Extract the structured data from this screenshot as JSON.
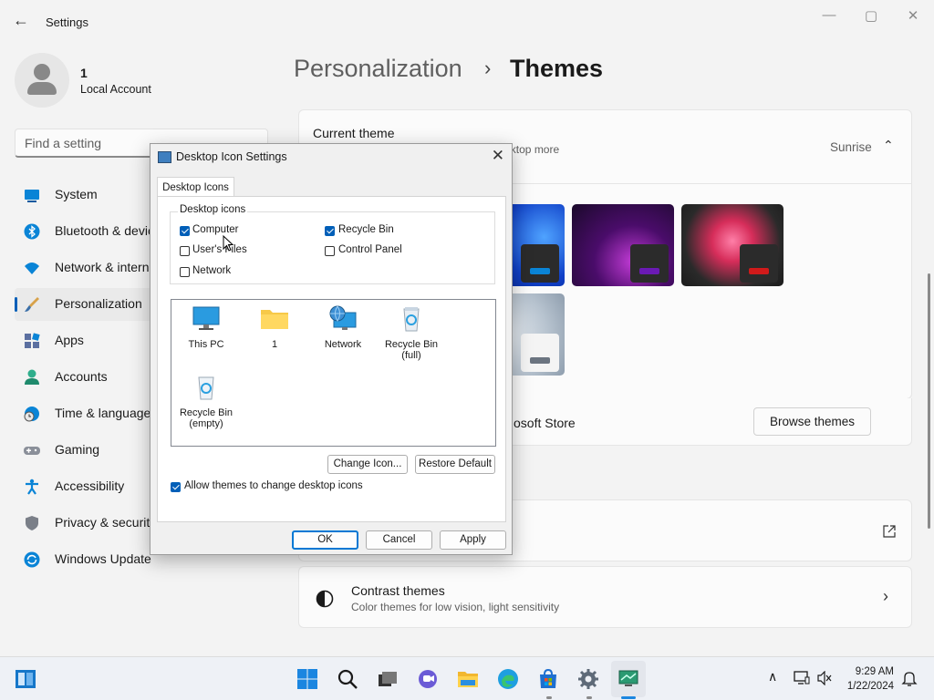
{
  "window": {
    "title": "Settings",
    "controls": {
      "minimize": "—",
      "maximize": "▢",
      "close": "✕"
    }
  },
  "user": {
    "name": "1",
    "account_type": "Local Account"
  },
  "search": {
    "placeholder": "Find a setting"
  },
  "sidebar": {
    "items": [
      {
        "label": "System",
        "icon": "system-icon"
      },
      {
        "label": "Bluetooth & devices",
        "icon": "bluetooth-icon"
      },
      {
        "label": "Network & internet",
        "icon": "network-icon"
      },
      {
        "label": "Personalization",
        "icon": "brush-icon",
        "active": true
      },
      {
        "label": "Apps",
        "icon": "apps-icon"
      },
      {
        "label": "Accounts",
        "icon": "accounts-icon"
      },
      {
        "label": "Time & language",
        "icon": "clock-globe-icon"
      },
      {
        "label": "Gaming",
        "icon": "gamepad-icon"
      },
      {
        "label": "Accessibility",
        "icon": "accessibility-icon"
      },
      {
        "label": "Privacy & security",
        "icon": "shield-icon"
      },
      {
        "label": "Windows Update",
        "icon": "update-icon"
      }
    ]
  },
  "breadcrumb": {
    "parent": "Personalization",
    "separator": "›",
    "current": "Themes"
  },
  "current_theme": {
    "label": "Current theme",
    "description": "nds, and colors together to give your desktop more",
    "value": "Sunrise"
  },
  "store": {
    "partial_text": "osoft Store",
    "browse_button": "Browse themes"
  },
  "contrast": {
    "title": "Contrast themes",
    "subtitle": "Color themes for low vision, light sensitivity"
  },
  "dialog": {
    "title": "Desktop Icon Settings",
    "close": "✕",
    "tab": "Desktop Icons",
    "group_label": "Desktop icons",
    "checkboxes": [
      {
        "label": "Computer",
        "checked": true
      },
      {
        "label": "Recycle Bin",
        "checked": true
      },
      {
        "label": "User's Files",
        "checked": false
      },
      {
        "label": "Control Panel",
        "checked": false
      },
      {
        "label": "Network",
        "checked": false
      }
    ],
    "icons": [
      {
        "label": "This PC",
        "icon": "monitor-icon"
      },
      {
        "label": "1",
        "icon": "folder-icon"
      },
      {
        "label": "Network",
        "icon": "network-globe-icon"
      },
      {
        "label": "Recycle Bin\n(full)",
        "icon": "recycle-bin-full-icon"
      },
      {
        "label": "Recycle Bin\n(empty)",
        "icon": "recycle-bin-empty-icon"
      }
    ],
    "change_icon": "Change Icon...",
    "restore_default": "Restore Default",
    "allow_themes": {
      "label": "Allow themes to change desktop icons",
      "checked": true
    },
    "ok": "OK",
    "cancel": "Cancel",
    "apply": "Apply"
  },
  "taskbar": {
    "time": "9:29 AM",
    "date": "1/22/2024",
    "chevron": "∧"
  },
  "colors": {
    "accent": "#005fb8",
    "taskbar": "#eef1f6"
  }
}
